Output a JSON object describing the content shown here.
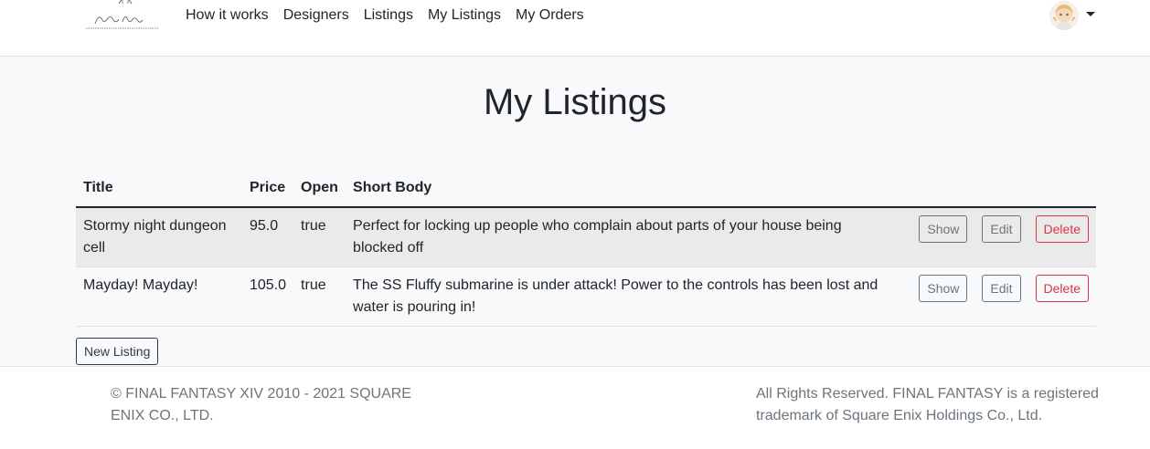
{
  "nav": {
    "links": [
      "How it works",
      "Designers",
      "Listings",
      "My Listings",
      "My Orders"
    ]
  },
  "main": {
    "title": "My Listings",
    "table": {
      "headers": [
        "Title",
        "Price",
        "Open",
        "Short Body"
      ],
      "rows": [
        {
          "title": "Stormy night dungeon cell",
          "price": "95.0",
          "open": "true",
          "body": "Perfect for locking up people who complain about parts of your house being blocked off"
        },
        {
          "title": "Mayday! Mayday!",
          "price": "105.0",
          "open": "true",
          "body": "The SS Fluffy submarine is under attack! Power to the controls has been lost and water is pouring in!"
        }
      ],
      "actions": {
        "show": "Show",
        "edit": "Edit",
        "delete": "Delete"
      }
    },
    "new_listing_label": "New Listing"
  },
  "footer": {
    "left": "© FINAL FANTASY XIV 2010 - 2021 SQUARE ENIX CO., LTD.",
    "right": "All Rights Reserved. FINAL FANTASY is a registered trademark of Square Enix Holdings Co., Ltd."
  },
  "colors": {
    "text": "#212529",
    "muted": "#6c757d",
    "danger": "#dc3545",
    "page_bg": "#f8f9fa",
    "stripe": "#eaeaeb"
  },
  "icons": {
    "brand": "logo-icon",
    "avatar": "user-avatar-icon",
    "caret": "chevron-down-icon"
  }
}
